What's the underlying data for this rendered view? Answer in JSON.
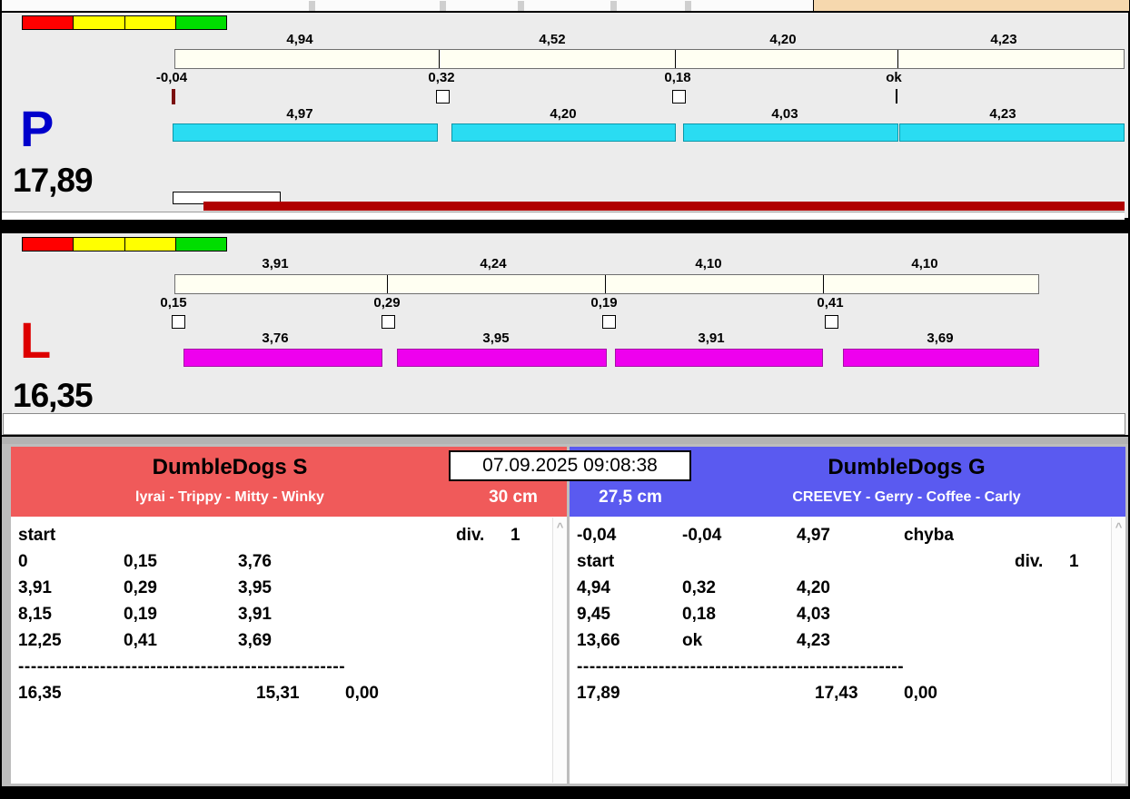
{
  "status_colors": [
    "#ff0000",
    "#ffff00",
    "#ffff00",
    "#00dd00"
  ],
  "colors": {
    "progress_bar": "#b00000",
    "lane_p_bar": "#2adcf2",
    "lane_l_bar": "#ee00ee",
    "left_header": "#f05a5a",
    "right_header": "#5a5af0",
    "tab_fragment": "#f6d8ae"
  },
  "timestamp": "07.09.2025 09:08:38",
  "ui": {
    "scroll_up": "^"
  },
  "lanes": {
    "p": {
      "letter": "P",
      "letter_color": "#0000cc",
      "total": "17,89",
      "segment_values": [
        "4,94",
        "4,52",
        "4,20",
        "4,23"
      ],
      "marker_labels": [
        "-0,04",
        "0,32",
        "0,18",
        "ok"
      ],
      "split_values": [
        "4,97",
        "4,20",
        "4,03",
        "4,23"
      ]
    },
    "l": {
      "letter": "L",
      "letter_color": "#dd0000",
      "total": "16,35",
      "segment_values": [
        "3,91",
        "4,24",
        "4,10",
        "4,10"
      ],
      "marker_labels": [
        "0,15",
        "0,29",
        "0,19",
        "0,41"
      ],
      "split_values": [
        "3,76",
        "3,95",
        "3,91",
        "3,69"
      ]
    }
  },
  "results": {
    "left": {
      "title": "DumbleDogs S",
      "subtitle": "lyrai - Trippy - Mitty - Winky",
      "jump_height": "30 cm",
      "lines": [
        [
          [
            "start",
            "0"
          ],
          [
            "div.",
            "4"
          ],
          [
            "1",
            "5"
          ]
        ],
        [
          [
            "0",
            "0"
          ],
          [
            "0,15",
            "1"
          ],
          [
            "3,76",
            "2"
          ]
        ],
        [
          [
            "3,91",
            "0"
          ],
          [
            "0,29",
            "1"
          ],
          [
            "3,95",
            "2"
          ]
        ],
        [
          [
            "8,15",
            "0"
          ],
          [
            "0,19",
            "1"
          ],
          [
            "3,91",
            "2"
          ]
        ],
        [
          [
            "12,25",
            "0"
          ],
          [
            "0,41",
            "1"
          ],
          [
            "3,69",
            "2"
          ]
        ],
        [
          [
            "----------------------------------------------------",
            "s"
          ]
        ],
        [
          [
            "16,35",
            "0"
          ],
          [
            "15,31",
            "6"
          ],
          [
            "0,00",
            "3"
          ]
        ]
      ]
    },
    "right": {
      "title": "DumbleDogs G",
      "subtitle": "CREEVEY - Gerry - Coffee - Carly",
      "jump_height": "27,5 cm",
      "lines": [
        [
          [
            "-0,04",
            "0"
          ],
          [
            "-0,04",
            "1"
          ],
          [
            "4,97",
            "2"
          ],
          [
            "chyba",
            "3"
          ]
        ],
        [
          [
            "start",
            "0"
          ],
          [
            "div.",
            "4"
          ],
          [
            "1",
            "5"
          ]
        ],
        [
          [
            "4,94",
            "0"
          ],
          [
            "0,32",
            "1"
          ],
          [
            "4,20",
            "2"
          ]
        ],
        [
          [
            "9,45",
            "0"
          ],
          [
            "0,18",
            "1"
          ],
          [
            "4,03",
            "2"
          ]
        ],
        [
          [
            "13,66",
            "0"
          ],
          [
            "ok",
            "1"
          ],
          [
            "4,23",
            "2"
          ]
        ],
        [
          [
            "----------------------------------------------------",
            "s"
          ]
        ],
        [
          [
            "17,89",
            "0"
          ],
          [
            "17,43",
            "6"
          ],
          [
            "0,00",
            "3"
          ]
        ]
      ]
    }
  }
}
